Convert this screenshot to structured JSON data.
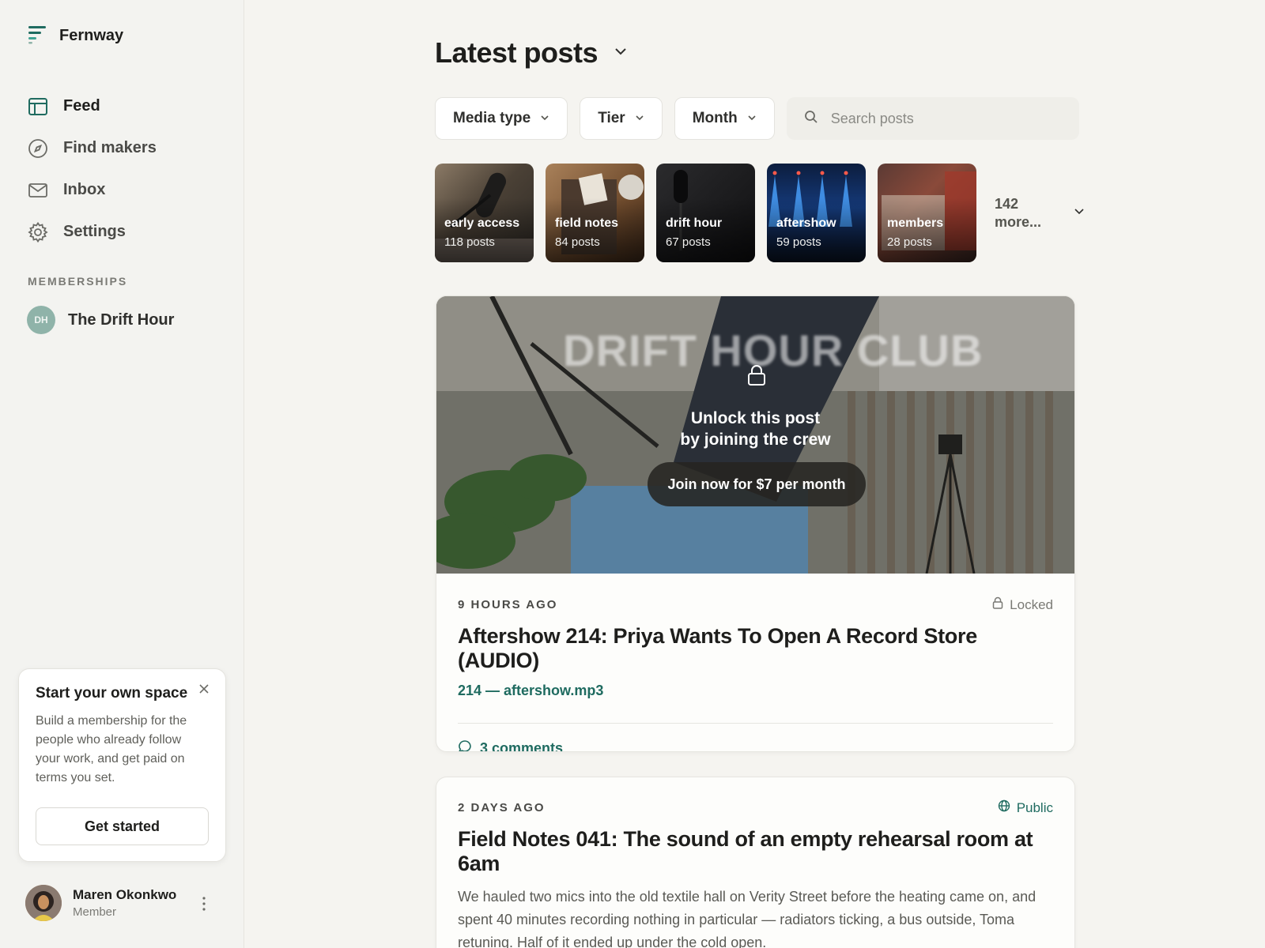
{
  "app": {
    "name": "Fernway"
  },
  "sidebar": {
    "nav": [
      {
        "label": "Feed",
        "icon": "layout-icon",
        "active": true
      },
      {
        "label": "Find makers",
        "icon": "compass-icon"
      },
      {
        "label": "Inbox",
        "icon": "mail-icon"
      },
      {
        "label": "Settings",
        "icon": "gear-icon"
      }
    ],
    "memberships_label": "MEMBERSHIPS",
    "memberships": [
      {
        "initials": "DH",
        "label": "The Drift Hour"
      }
    ],
    "promo": {
      "title": "Start your own space",
      "body": "Build a membership for the people who already follow your work, and get paid on terms you set.",
      "button": "Get started"
    },
    "user": {
      "name": "Maren Okonkwo",
      "role": "Member"
    }
  },
  "main": {
    "title": "Latest posts",
    "filters": [
      "Media type",
      "Tier",
      "Month"
    ],
    "search_placeholder": "Search posts",
    "collections": [
      {
        "name": "early access",
        "count": "118 posts"
      },
      {
        "name": "field notes",
        "count": "84 posts"
      },
      {
        "name": "drift hour",
        "count": "67 posts"
      },
      {
        "name": "aftershow",
        "count": "59 posts"
      },
      {
        "name": "members",
        "count": "28 posts"
      }
    ],
    "more_label": "142 more...",
    "posts": [
      {
        "hero_wordmark": "DRIFT HOUR CLUB",
        "unlock_line1": "Unlock this post",
        "unlock_line2": "by joining the crew",
        "join_label": "Join now for $7 per month",
        "time": "9 HOURS AGO",
        "status": "Locked",
        "title": "Aftershow 214: Priya Wants To Open A Record Store (AUDIO)",
        "attachment": "214 — aftershow.mp3",
        "comments": "3 comments"
      },
      {
        "time": "2 DAYS AGO",
        "status": "Public",
        "title": "Field Notes 041: The sound of an empty rehearsal room at 6am",
        "excerpt": "We hauled two mics into the old textile hall on Verity Street before the heating came on, and spent 40 minutes recording nothing in particular — radiators ticking, a bus outside, Toma retuning. Half of it ended up under the cold open."
      }
    ]
  },
  "colors": {
    "accent": "#1f6b60",
    "background": "#f5f4f0",
    "card": "#fdfdfb"
  }
}
